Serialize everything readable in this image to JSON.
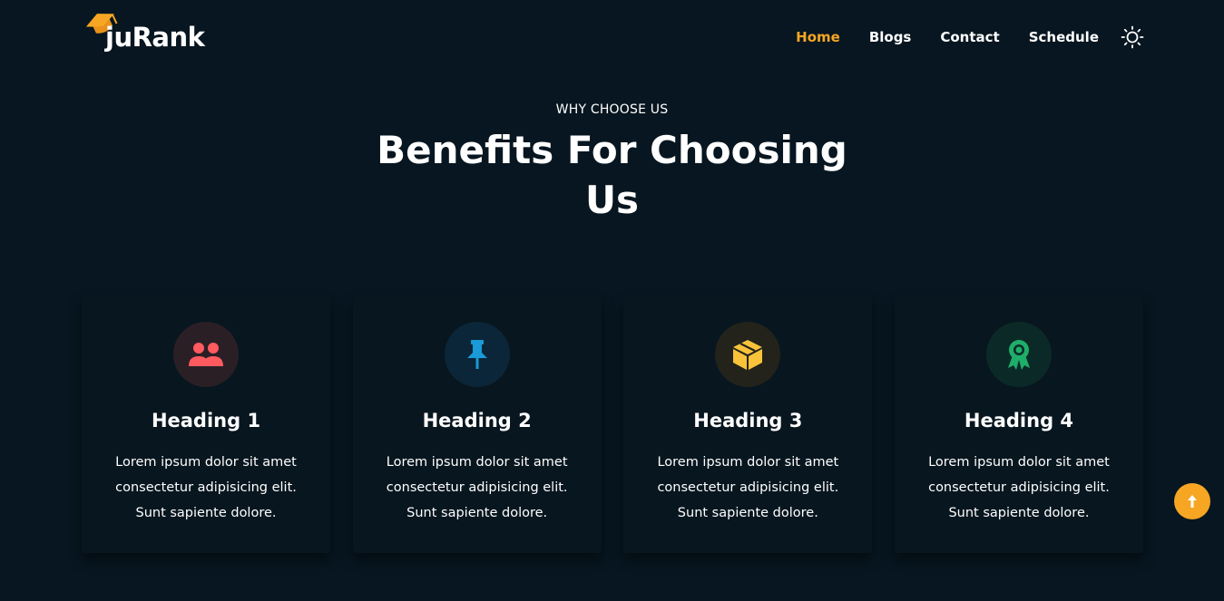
{
  "brand": {
    "name": "juRank",
    "icon": "graduation-cap-icon",
    "accent": "#f6a623"
  },
  "nav": {
    "items": [
      {
        "label": "Home",
        "active": true
      },
      {
        "label": "Blogs",
        "active": false
      },
      {
        "label": "Contact",
        "active": false
      },
      {
        "label": "Schedule",
        "active": false
      }
    ],
    "theme_icon": "sun-icon"
  },
  "section": {
    "eyebrow": "WHY CHOOSE US",
    "title": "Benefits For Choosing Us"
  },
  "cards": [
    {
      "heading": "Heading 1",
      "text": "Lorem ipsum dolor sit amet consectetur adipisicing elit. Sunt sapiente dolore.",
      "icon": "users-icon",
      "color": "#ff5a5f",
      "bg": "#2b1f26"
    },
    {
      "heading": "Heading 2",
      "text": "Lorem ipsum dolor sit amet consectetur adipisicing elit. Sunt sapiente dolore.",
      "icon": "pushpin-icon",
      "color": "#1a9ad6",
      "bg": "#0b2638"
    },
    {
      "heading": "Heading 3",
      "text": "Lorem ipsum dolor sit amet consectetur adipisicing elit. Sunt sapiente dolore.",
      "icon": "box-icon",
      "color": "#f8c33a",
      "bg": "#23231c"
    },
    {
      "heading": "Heading 4",
      "text": "Lorem ipsum dolor sit amet consectetur adipisicing elit. Sunt sapiente dolore.",
      "icon": "award-icon",
      "color": "#1fae6a",
      "bg": "#0b2a27"
    }
  ],
  "scroll_top": {
    "icon": "arrow-up-icon"
  }
}
